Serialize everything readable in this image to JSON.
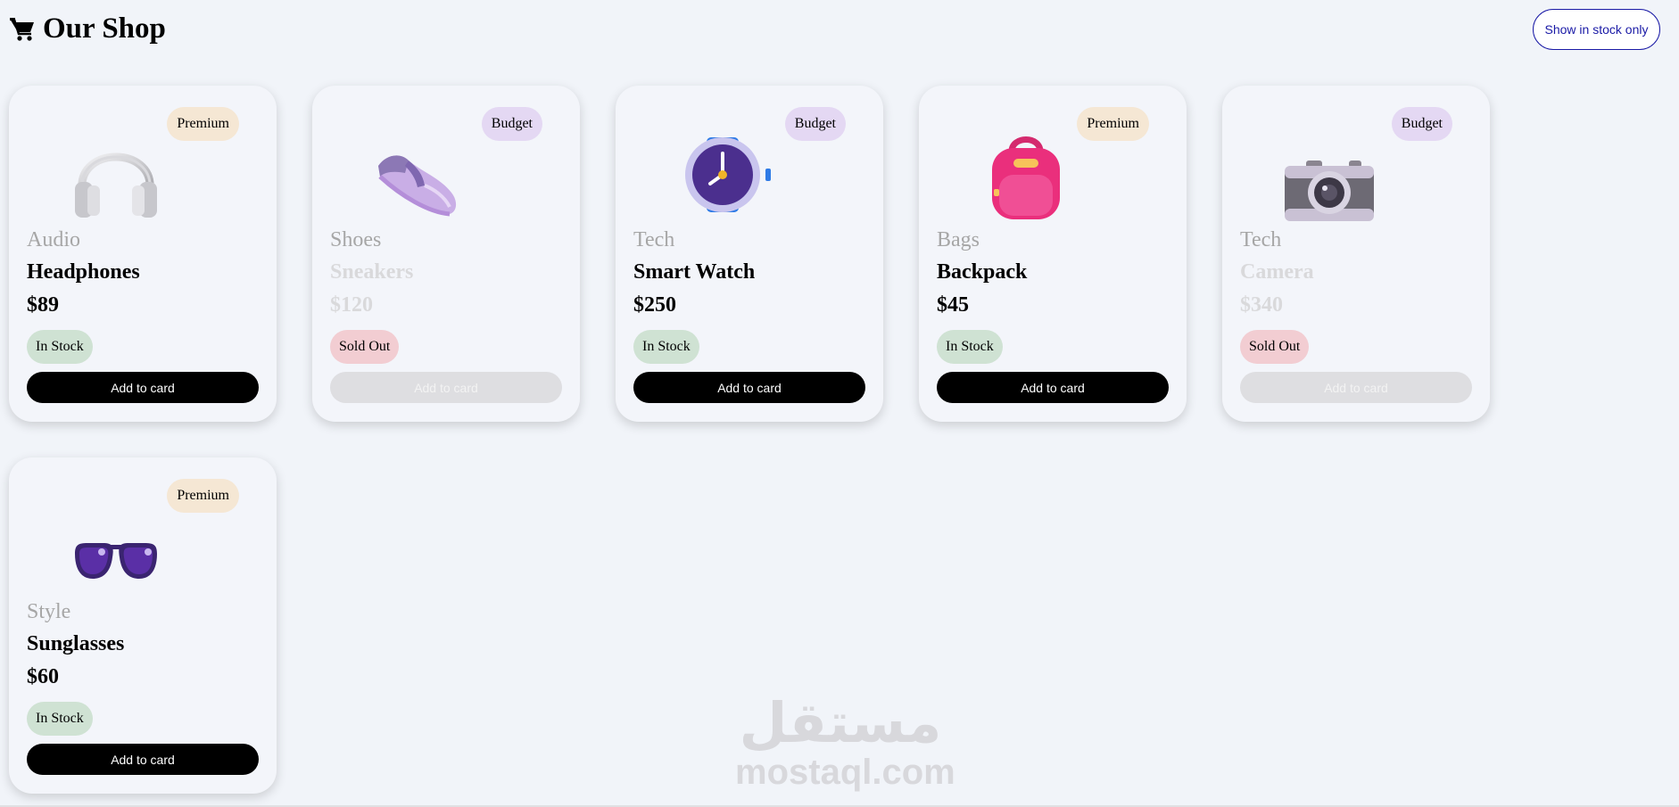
{
  "header": {
    "title": "Our Shop",
    "filter_label": "Show in stock only"
  },
  "products": [
    {
      "badge": "Premium",
      "category": "Audio",
      "name": "Headphones",
      "price": "$89",
      "stock": "In Stock",
      "button": "Add to card",
      "icon": "headphones-icon"
    },
    {
      "badge": "Budget",
      "category": "Shoes",
      "name": "Sneakers",
      "price": "$120",
      "stock": "Sold Out",
      "button": "Add to card",
      "icon": "sneaker-icon"
    },
    {
      "badge": "Budget",
      "category": "Tech",
      "name": "Smart Watch",
      "price": "$250",
      "stock": "In Stock",
      "button": "Add to card",
      "icon": "watch-icon"
    },
    {
      "badge": "Premium",
      "category": "Bags",
      "name": "Backpack",
      "price": "$45",
      "stock": "In Stock",
      "button": "Add to card",
      "icon": "backpack-icon"
    },
    {
      "badge": "Budget",
      "category": "Tech",
      "name": "Camera",
      "price": "$340",
      "stock": "Sold Out",
      "button": "Add to card",
      "icon": "camera-icon"
    },
    {
      "badge": "Premium",
      "category": "Style",
      "name": "Sunglasses",
      "price": "$60",
      "stock": "In Stock",
      "button": "Add to card",
      "icon": "sunglasses-icon"
    }
  ],
  "watermark": {
    "arabic": "مستقل",
    "latin": "mostaql.com"
  },
  "colors": {
    "background": "#f1f4f9",
    "button": "#000000",
    "filter_accent": "#1a1aa6",
    "premium_badge": "#f5e7d4",
    "budget_badge": "#e4d8f3",
    "in_stock": "#cfe2d3",
    "sold_out": "#f2cdd2"
  }
}
